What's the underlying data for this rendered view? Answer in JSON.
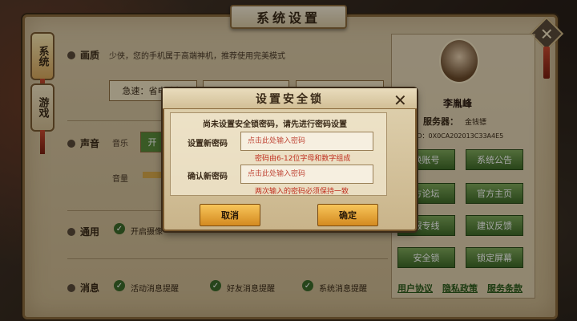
{
  "main": {
    "title": "系统设置",
    "side_tabs": [
      "系统",
      "游戏"
    ],
    "sections": {
      "quality": {
        "label": "画质",
        "notice": "少侠，您的手机属于高端神机，推荐使用完美模式",
        "options": [
          "急速：省电流畅"
        ]
      },
      "sound": {
        "label": "声音",
        "music": "音乐",
        "music_toggle": "开",
        "volume": "音量"
      },
      "general": {
        "label": "通用",
        "check_1": "开启摄像"
      },
      "message": {
        "label": "消息",
        "checks": [
          "活动消息提醒",
          "好友消息提醒",
          "系统消息提醒"
        ]
      }
    }
  },
  "profile": {
    "name": "李胤峰",
    "server_label": "服务器：",
    "server_name": "金钱镖",
    "id": "ID：0X0CA202013C33A4E5",
    "buttons": [
      "换账号",
      "系统公告",
      "方论坛",
      "官方主页",
      "服专线",
      "建议反馈",
      "安全锁",
      "锁定屏幕"
    ],
    "links": [
      "用户协议",
      "隐私政策",
      "服务条款"
    ]
  },
  "dialog": {
    "title": "设置安全锁",
    "notice": "尚未设置安全锁密码，请先进行密码设置",
    "new_label": "设置新密码",
    "confirm_label": "确认新密码",
    "placeholder": "点击此处输入密码",
    "hint_new": "密码由6-12位字母和数字组成",
    "hint_confirm": "两次输入的密码必须保持一致",
    "cancel": "取消",
    "ok": "确定"
  }
}
